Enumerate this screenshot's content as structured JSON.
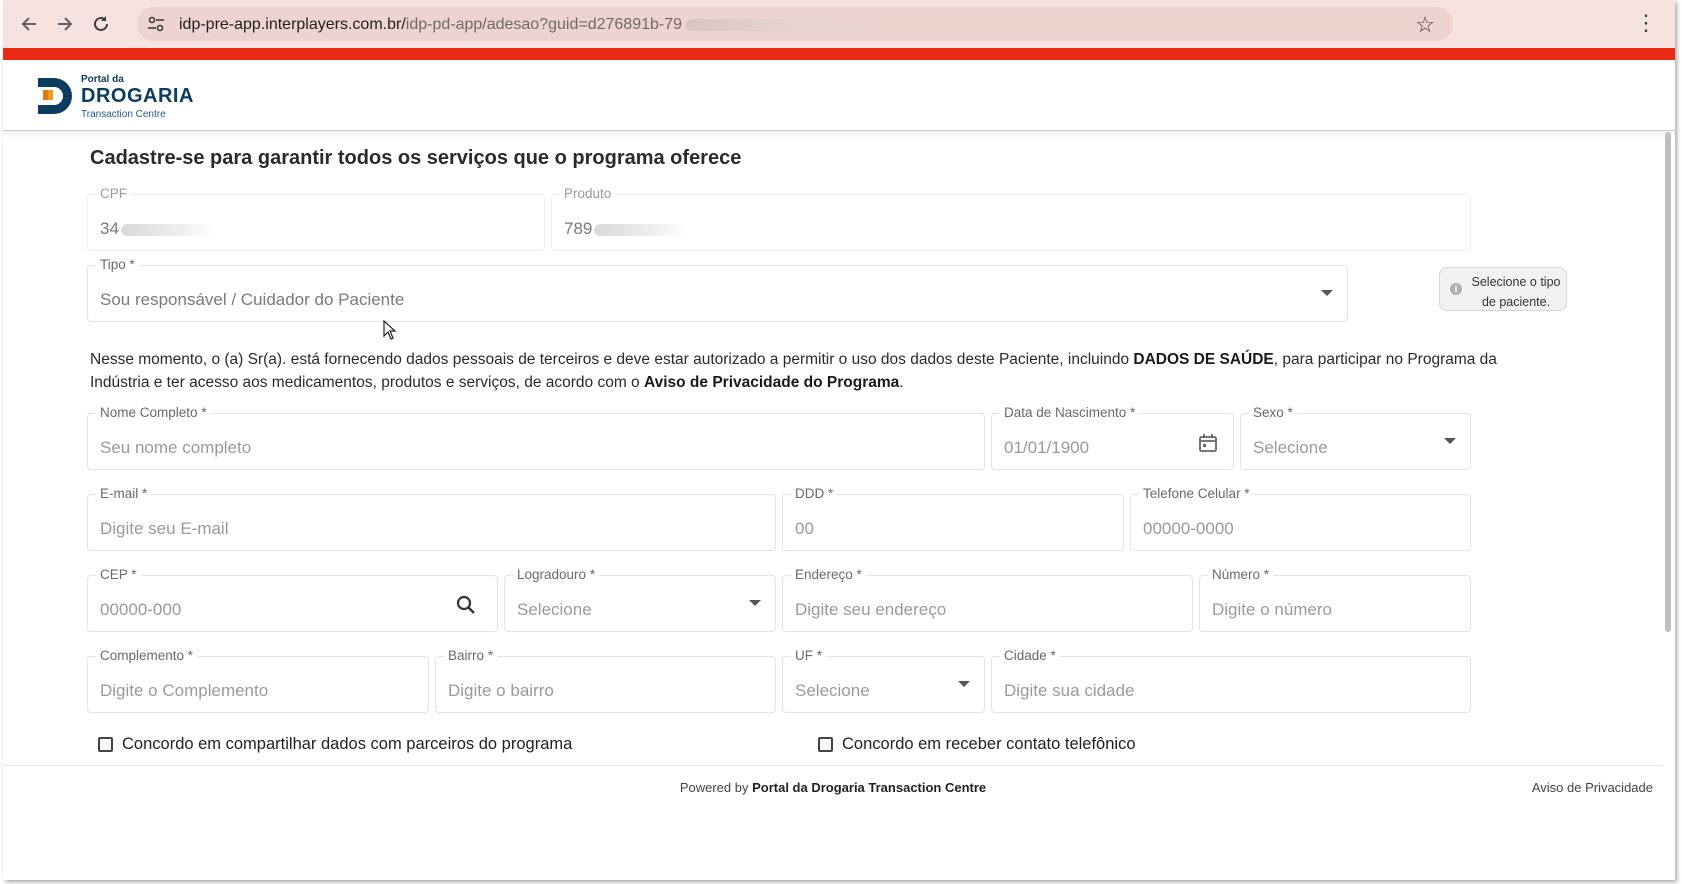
{
  "browser": {
    "url_host": "idp-pre-app.interplayers.com.br/",
    "url_path": "idp-pd-app/adesao?guid=d276891b-79",
    "icons": [
      "back-icon",
      "forward-icon",
      "reload-icon",
      "site-settings-icon",
      "star-icon",
      "menu-dots-icon"
    ]
  },
  "header": {
    "logo_small": "Portal da",
    "logo_big": "DROGARIA",
    "logo_sub": "Transaction Centre"
  },
  "page": {
    "title": "Cadastre-se para garantir todos os serviços que o programa oferece"
  },
  "form": {
    "cpf": {
      "label": "CPF",
      "value": "34"
    },
    "produto": {
      "label": "Produto",
      "value": "789"
    },
    "tipo": {
      "label": "Tipo *",
      "value": "Sou responsável / Cuidador do Paciente"
    },
    "tipo_hint": "Selecione o tipo de paciente.",
    "notice": {
      "part1": "Nesse momento, o (a) Sr(a). está fornecendo dados pessoais de terceiros e deve estar autorizado a permitir o uso dos dados deste Paciente, incluindo ",
      "bold1": "DADOS DE SAÚDE",
      "part2": ", para participar no Programa da Indústria e ter acesso aos medicamentos, produtos e serviços, de acordo com o ",
      "bold2": "Aviso de Privacidade do Programa",
      "part3": "."
    },
    "nome": {
      "label": "Nome Completo *",
      "placeholder": "Seu nome completo"
    },
    "nascimento": {
      "label": "Data de Nascimento *",
      "placeholder": "01/01/1900"
    },
    "sexo": {
      "label": "Sexo *",
      "placeholder": "Selecione"
    },
    "email": {
      "label": "E-mail *",
      "placeholder": "Digite seu E-mail"
    },
    "ddd": {
      "label": "DDD *",
      "placeholder": "00"
    },
    "telefone": {
      "label": "Telefone Celular *",
      "placeholder": "00000-0000"
    },
    "cep": {
      "label": "CEP *",
      "placeholder": "00000-000"
    },
    "logradouro": {
      "label": "Logradouro *",
      "placeholder": "Selecione"
    },
    "endereco": {
      "label": "Endereço *",
      "placeholder": "Digite seu endereço"
    },
    "numero": {
      "label": "Número *",
      "placeholder": "Digite o número"
    },
    "complemento": {
      "label": "Complemento *",
      "placeholder": "Digite o Complemento"
    },
    "bairro": {
      "label": "Bairro *",
      "placeholder": "Digite o bairro"
    },
    "uf": {
      "label": "UF *",
      "placeholder": "Selecione"
    },
    "cidade": {
      "label": "Cidade *",
      "placeholder": "Digite sua cidade"
    },
    "consent_partners": "Concordo em compartilhar dados com parceiros do programa",
    "consent_phone": "Concordo em receber contato telefônico"
  },
  "footer": {
    "powered_prefix": "Powered by ",
    "powered_name": "Portal da Drogaria Transaction Centre",
    "privacy": "Aviso de Privacidade"
  },
  "colors": {
    "brand_blue": "#0d3c61",
    "brand_orange": "#f39a1e",
    "alert_red": "#ea2a14"
  }
}
